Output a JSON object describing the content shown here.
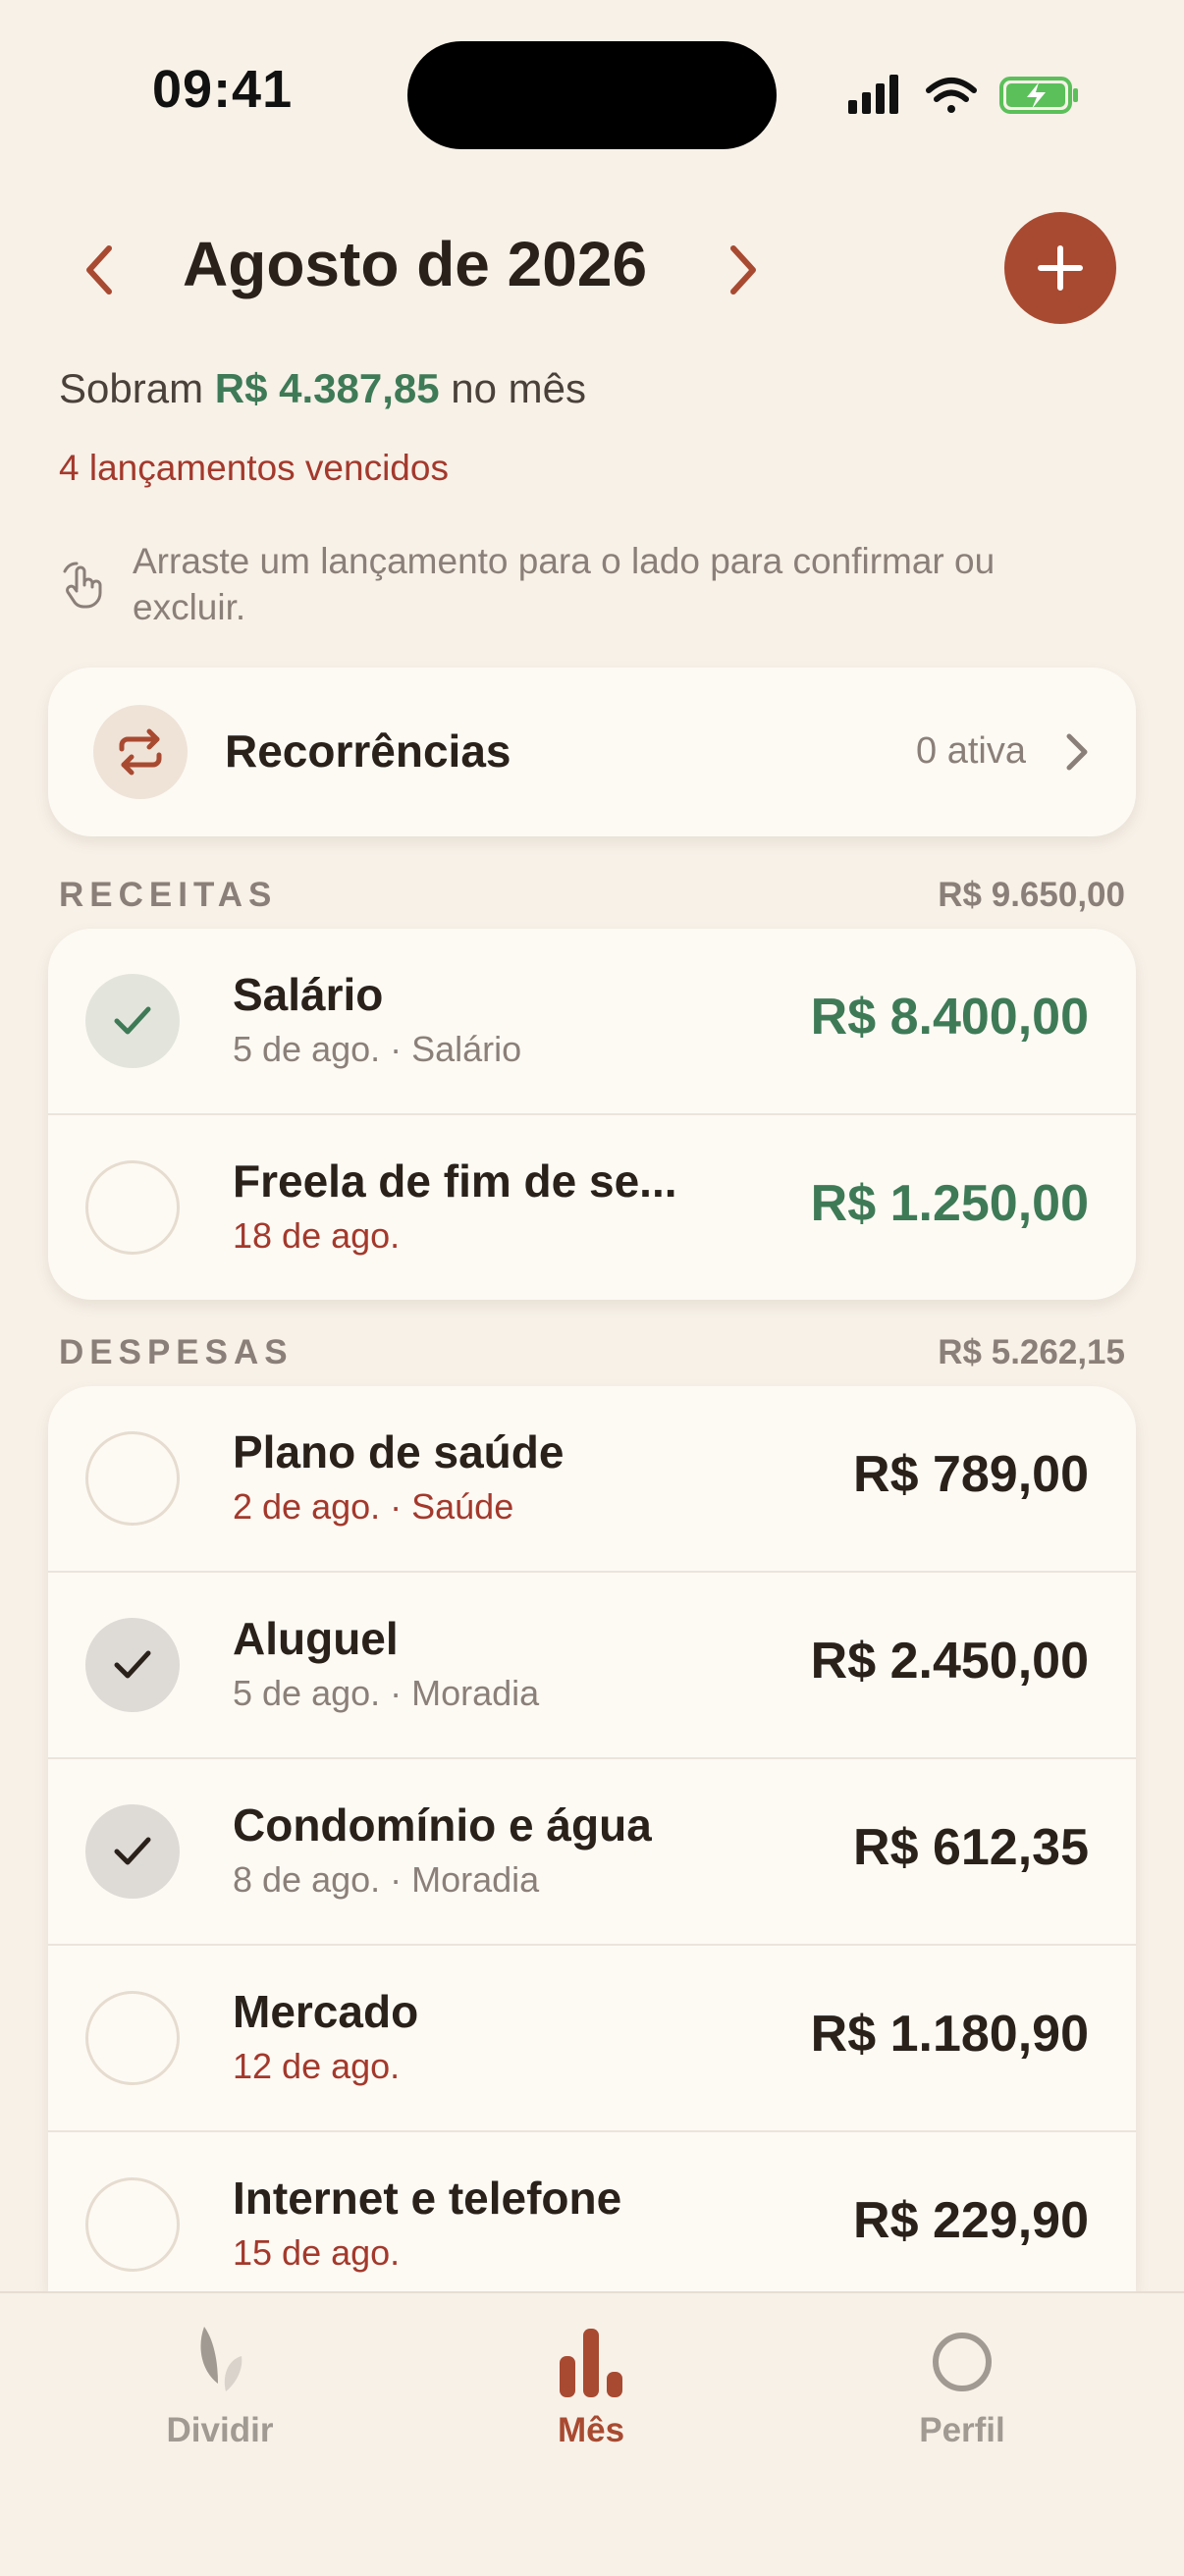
{
  "status_bar": {
    "time": "09:41"
  },
  "header": {
    "title": "Agosto de 2026",
    "summary_prefix": "Sobram",
    "summary_amount": "R$ 4.387,85",
    "summary_suffix": "no mês",
    "overdue_text": "4 lançamentos vencidos",
    "hint_text": "Arraste um lançamento para o lado para confirmar ou excluir."
  },
  "recurrences": {
    "label": "Recorrências",
    "count": "0 ativa"
  },
  "income": {
    "title": "RECEITAS",
    "total": "R$ 9.650,00",
    "items": [
      {
        "title": "Salário",
        "subtitle": "5 de ago. · Salário",
        "amount": "R$ 8.400,00",
        "confirmed": true,
        "late": false
      },
      {
        "title": "Freela de fim de se...",
        "subtitle": "18 de ago.",
        "amount": "R$ 1.250,00",
        "confirmed": false,
        "late": true
      }
    ]
  },
  "expenses": {
    "title": "DESPESAS",
    "total": "R$ 5.262,15",
    "items": [
      {
        "title": "Plano de saúde",
        "subtitle": "2 de ago. · Saúde",
        "amount": "R$ 789,00",
        "confirmed": false,
        "late": true
      },
      {
        "title": "Aluguel",
        "subtitle": "5 de ago. · Moradia",
        "amount": "R$ 2.450,00",
        "confirmed": true,
        "late": false
      },
      {
        "title": "Condomínio e água",
        "subtitle": "8 de ago. · Moradia",
        "amount": "R$ 612,35",
        "confirmed": true,
        "late": false
      },
      {
        "title": "Mercado",
        "subtitle": "12 de ago.",
        "amount": "R$ 1.180,90",
        "confirmed": false,
        "late": true
      },
      {
        "title": "Internet e telefone",
        "subtitle": "15 de ago.",
        "amount": "R$ 229,90",
        "confirmed": false,
        "late": true
      }
    ]
  },
  "tabs": [
    {
      "label": "Dividir",
      "icon": "leaf-icon",
      "active": false
    },
    {
      "label": "Mês",
      "icon": "bar-chart-icon",
      "active": true
    },
    {
      "label": "Perfil",
      "icon": "profile-circle-icon",
      "active": false
    }
  ],
  "colors": {
    "accent": "#a84a31",
    "positive": "#3f7a57",
    "overdue": "#a3392c",
    "background": "#f7f1e8"
  }
}
